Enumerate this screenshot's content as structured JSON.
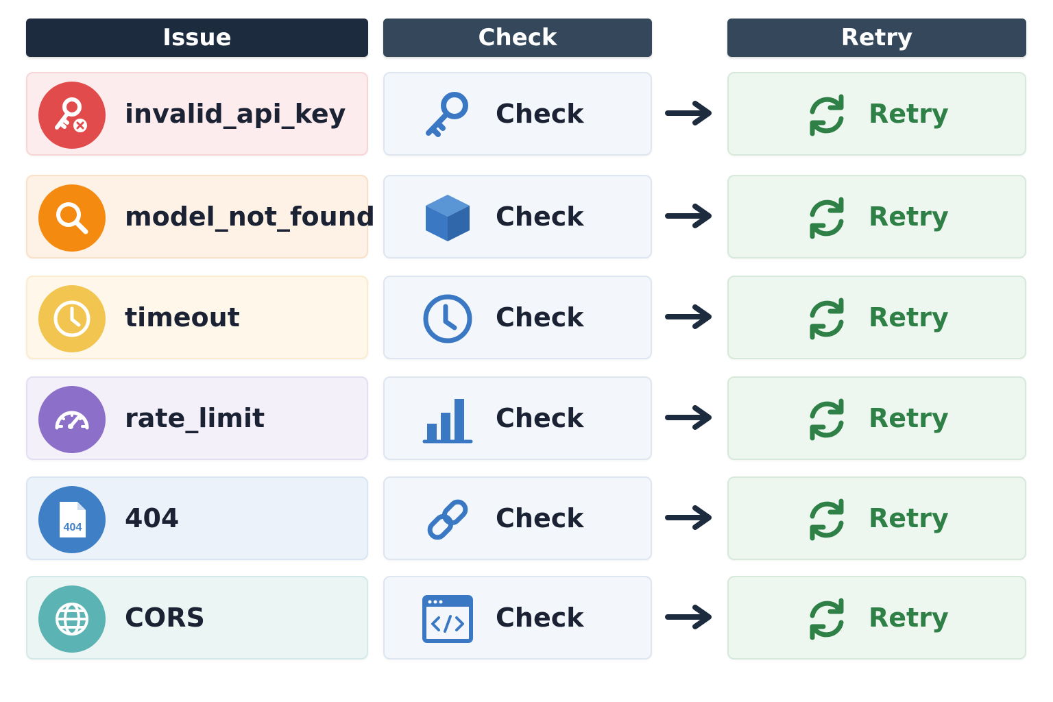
{
  "headers": {
    "issue": "Issue",
    "check": "Check",
    "retry": "Retry"
  },
  "rows": [
    {
      "issue": "invalid_api_key",
      "issue_icon": "key-error-icon",
      "issue_color": "#e24b4b",
      "check_label": "Check",
      "check_icon": "key-icon",
      "retry_label": "Retry"
    },
    {
      "issue": "model_not_found",
      "issue_icon": "search-icon",
      "issue_color": "#f58a10",
      "check_label": "Check",
      "check_icon": "cube-icon",
      "retry_label": "Retry"
    },
    {
      "issue": "timeout",
      "issue_icon": "clock-icon",
      "issue_color": "#f1c550",
      "check_label": "Check",
      "check_icon": "clock-icon",
      "retry_label": "Retry"
    },
    {
      "issue": "rate_limit",
      "issue_icon": "gauge-icon",
      "issue_color": "#8b6fc8",
      "check_label": "Check",
      "check_icon": "bar-chart-icon",
      "retry_label": "Retry"
    },
    {
      "issue": "404",
      "issue_icon": "file-404-icon",
      "issue_color": "#3f7fc6",
      "file_badge": "404",
      "check_label": "Check",
      "check_icon": "link-icon",
      "retry_label": "Retry"
    },
    {
      "issue": "CORS",
      "issue_icon": "globe-icon",
      "issue_color": "#5cb3b3",
      "check_label": "Check",
      "check_icon": "browser-code-icon",
      "retry_label": "Retry"
    }
  ],
  "colors": {
    "header_dark": "#1c2b3e",
    "header": "#34475b",
    "check_blue": "#3a78c3",
    "retry_green": "#2e8046",
    "arrow": "#1c2b3e"
  }
}
